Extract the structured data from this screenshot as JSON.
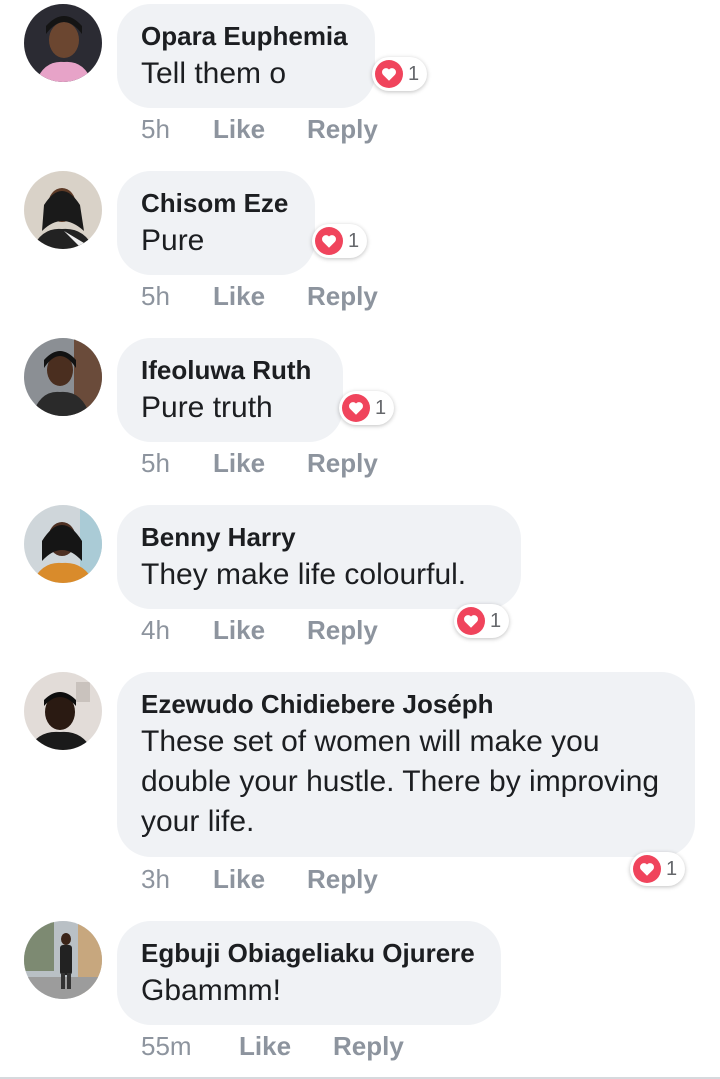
{
  "comments": [
    {
      "name": "Opara Euphemia",
      "text": "Tell them o",
      "time": "5h",
      "like": "Like",
      "reply": "Reply",
      "reactions": "1",
      "reaction_icon": "heart-icon"
    },
    {
      "name": "Chisom Eze",
      "text": "Pure",
      "time": "5h",
      "like": "Like",
      "reply": "Reply",
      "reactions": "1",
      "reaction_icon": "heart-icon"
    },
    {
      "name": "Ifeoluwa Ruth",
      "text": "Pure truth",
      "time": "5h",
      "like": "Like",
      "reply": "Reply",
      "reactions": "1",
      "reaction_icon": "heart-icon"
    },
    {
      "name": "Benny Harry",
      "text": "They make life colourful.",
      "time": "4h",
      "like": "Like",
      "reply": "Reply",
      "reactions": "1",
      "reaction_icon": "heart-icon"
    },
    {
      "name": "Ezewudo Chidiebere Joséph",
      "text": "These set of women will make you double your hustle. There by improving your life.",
      "time": "3h",
      "like": "Like",
      "reply": "Reply",
      "reactions": "1",
      "reaction_icon": "heart-icon"
    },
    {
      "name": "Egbuji Obiageliaku Ojurere",
      "text": "Gbammm!",
      "time": "55m",
      "like": "Like",
      "reply": "Reply"
    }
  ],
  "colors": {
    "bubble": "#f0f2f5",
    "heart": "#f0445c",
    "meta": "#8d949e",
    "name": "#1c1e21"
  }
}
